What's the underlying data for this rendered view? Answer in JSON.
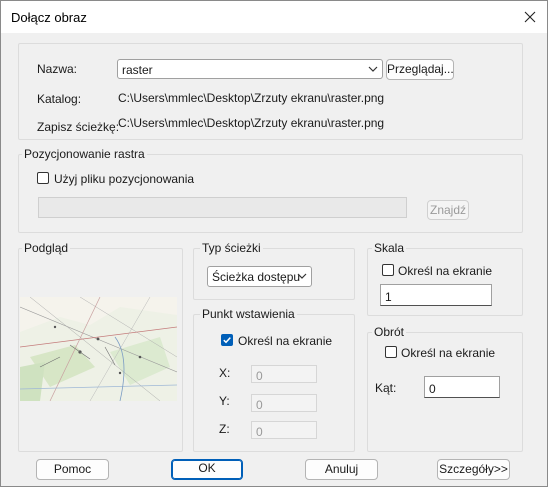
{
  "window": {
    "title": "Dołącz obraz"
  },
  "name_row": {
    "label": "Nazwa:",
    "value": "raster",
    "browse_label": "Przeglądaj..."
  },
  "directory": {
    "label": "Katalog:",
    "value": "C:\\Users\\mmlec\\Desktop\\Zrzuty ekranu\\raster.png"
  },
  "save_path": {
    "label": "Zapisz ścieżkę:",
    "value": "C:\\Users\\mmlec\\Desktop\\Zrzuty ekranu\\raster.png"
  },
  "positioning": {
    "group_title": "Pozycjonowanie rastra",
    "use_file_label": "Użyj pliku pozycjonowania",
    "use_file_checked": false,
    "find_label": "Znajdź"
  },
  "preview": {
    "group_title": "Podgląd"
  },
  "path_type": {
    "group_title": "Typ ścieżki",
    "selected": "Ścieżka dostępu"
  },
  "insertion": {
    "group_title": "Punkt wstawienia",
    "specify_label": "Określ na ekranie",
    "specify_checked": true,
    "x_label": "X:",
    "x_value": "0",
    "y_label": "Y:",
    "y_value": "0",
    "z_label": "Z:",
    "z_value": "0"
  },
  "scale": {
    "group_title": "Skala",
    "specify_label": "Określ na ekranie",
    "specify_checked": false,
    "value": "1"
  },
  "rotation": {
    "group_title": "Obrót",
    "specify_label": "Określ na ekranie",
    "specify_checked": false,
    "angle_label": "Kąt:",
    "angle_value": "0"
  },
  "buttons": {
    "help": "Pomoc",
    "ok": "OK",
    "cancel": "Anuluj",
    "details": "Szczegóły>>"
  },
  "colors": {
    "accent": "#005fb8",
    "background": "#f0f0f0"
  }
}
